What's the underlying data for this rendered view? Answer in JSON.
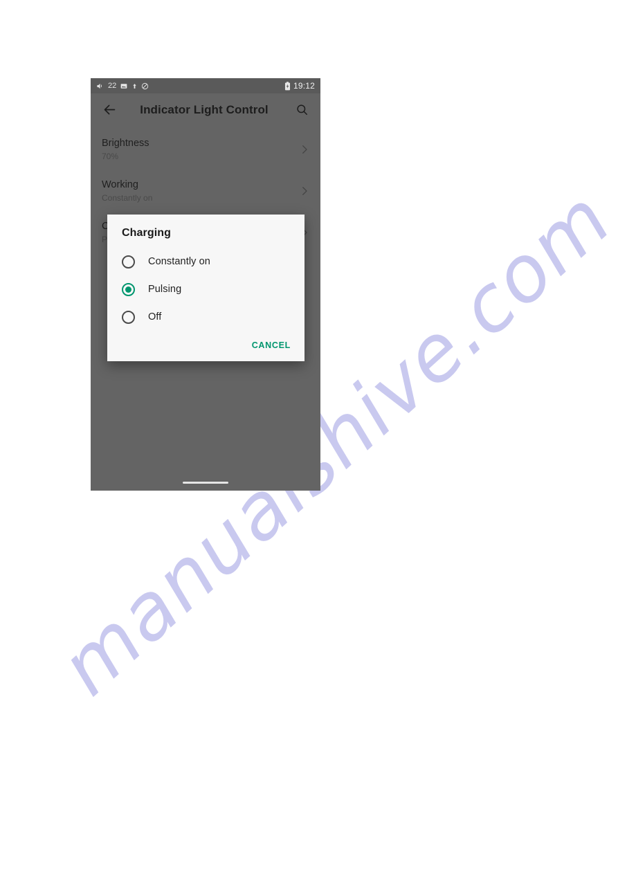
{
  "page": {
    "background_color": "#ffffff",
    "watermark": {
      "text": "manualshive.com",
      "color": "#c9c9ef"
    }
  },
  "phone": {
    "scrim_color": "#646464",
    "status_bar": {
      "background_color": "#5a5a5a",
      "volume_value": "22",
      "icons": [
        "volume-icon",
        "screenshot-icon",
        "upload-arrow-icon",
        "do-not-disturb-icon"
      ],
      "battery_icon": "battery-charging-icon",
      "clock": "19:12"
    },
    "app_bar": {
      "back_icon": "back-arrow-icon",
      "title": "Indicator Light Control",
      "search_icon": "search-icon"
    },
    "settings_list": [
      {
        "title": "Brightness",
        "subtitle": "70%",
        "chevron": "chevron-right-icon"
      },
      {
        "title": "Working",
        "subtitle": "Constantly on",
        "chevron": "chevron-right-icon"
      },
      {
        "title": "Charging",
        "subtitle": "Pulsing",
        "chevron": "chevron-right-icon"
      }
    ],
    "home_indicator": "home-indicator-bar"
  },
  "dialog": {
    "title": "Charging",
    "accent_color": "#00966e",
    "background_color": "#f7f7f7",
    "options": [
      {
        "label": "Constantly on",
        "selected": false
      },
      {
        "label": "Pulsing",
        "selected": true
      },
      {
        "label": "Off",
        "selected": false
      }
    ],
    "cancel_label": "CANCEL"
  }
}
